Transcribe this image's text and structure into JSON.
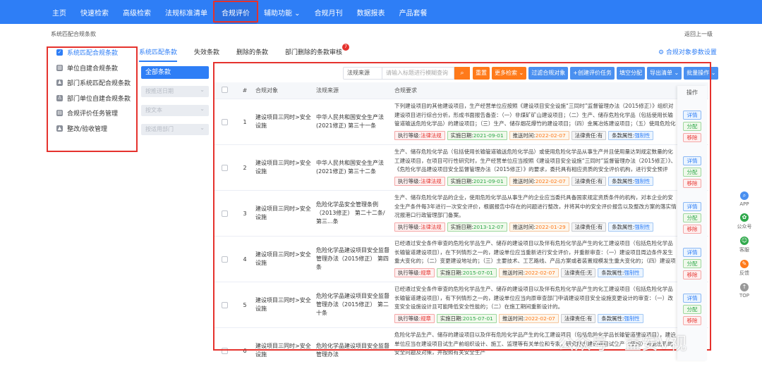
{
  "nav": {
    "items": [
      "主页",
      "快速检索",
      "高级检索",
      "法规标准清单",
      "合规评价",
      "辅助功能",
      "合规月刊",
      "数据报表",
      "产品套餐"
    ],
    "active_index": 4,
    "dropdown_index": 5
  },
  "breadcrumb": "系统匹配合规条款",
  "back_link": "返回上一级",
  "sidebar": {
    "items": [
      {
        "label": "系统匹配合规条款",
        "icon": "checkbox-icon",
        "active": true
      },
      {
        "label": "单位自建合规条款",
        "icon": "building-icon",
        "active": false
      },
      {
        "label": "部门系统匹配合规条款",
        "icon": "department-icon",
        "active": false
      },
      {
        "label": "部门单位自建合规条款",
        "icon": "department-user-icon",
        "active": false
      },
      {
        "label": "合规评价任务管理",
        "icon": "task-icon",
        "active": false
      },
      {
        "label": "整改/验收管理",
        "icon": "warning-icon",
        "active": false
      }
    ]
  },
  "tabs": {
    "items": [
      "系统匹配条款",
      "失效条款",
      "删除的条款",
      "部门删除的条款审核"
    ],
    "active_index": 0,
    "badge": "7"
  },
  "settings_link": "⚙ 合规对象参数设置",
  "filters": {
    "all": "全部条款",
    "selects": [
      "按推送日期",
      "按文本",
      "按适用部门"
    ]
  },
  "toolbar": {
    "source_select": "法规来源",
    "search_placeholder": "请输入标题进行模糊查询",
    "buttons": [
      "重置",
      "更多检索 ⌄",
      "过滤合规对象",
      "+创建评价任务",
      "填空分配",
      "导出清单 ⌄",
      "批量操作 ⌄"
    ]
  },
  "table": {
    "headers": [
      "#",
      "合规对象",
      "法规来源",
      "合规要求",
      "操作"
    ],
    "tag_labels": {
      "level": "执行等级:",
      "impl": "实施日期:",
      "push": "推送时间:",
      "resp": "法律责任:",
      "attr": "条款属性:"
    },
    "op_labels": [
      "详情",
      "分配",
      "移除"
    ],
    "rows": [
      {
        "no": "1",
        "obj": "建设项目三同时>安全设施",
        "src": "中华人民共和国安全生产法(2021修正) 第三十一条",
        "req": "下列建设项目的其他建设项目，生产经营单位应按照《建设项目安全设施“三同时”监督管理办法（2015修正）》组织对建设项目进行综合分析，形成书面报告备查：（一）非煤矿矿山建设项目；（二）生产、储存危险化学品（包括使用长输管道输送危险化学品）的建设项目；（三）生产、储存烟花爆竹的建设项目；（四）金属冶炼建设项目；（五）使用危险化学品从事生产并且使用量达到规定数量的化工建设项目；（六）法律、行政法规和国务院规定的其他建设项目。",
        "level": "法律法规",
        "impl": "2021-09-01",
        "push": "2022-02-07",
        "resp": "有",
        "attr": "强制性"
      },
      {
        "no": "2",
        "obj": "建设项目三同时>安全设施",
        "src": "中华人民共和国安全生产法(2021修正) 第三十二条",
        "req": "生产、储存危险化学品（包括使用长输管道输送危险化学品）或使用危险化学品从事生产并且使用量达到规定数量的化工建设项目，在项目可行性研究时，生产经营单位应当按照《建设项目安全设施“三同时”监督管理办法（2015修正）》、《危险化学品建设项目安全监督管理办法（2015修正）》的要求，委托具有相应资质的安全评价机构，进行安全预评价，并编制安全预评价报告。",
        "level": "法律法规",
        "impl": "2021-09-01",
        "push": "2022-02-07",
        "resp": "有",
        "attr": "强制性"
      },
      {
        "no": "3",
        "obj": "建设项目三同时>安全设施",
        "src": "危险化学品安全管理条例（2013修正） 第二十二条/第三...条",
        "req": "生产、储存危险化学品的企业，使用危险化学品从事生产的企业应当委托具备国家规定资质条件的机构，对本企业的安全生产条件每3年进行一次安全评价，根据报告中存在的问题进行整改，并将其中的安全评价报告以及整改方案的落实情况报港口行政管理部门备案。",
        "level": "法律法规",
        "impl": "2013-12-07",
        "push": "2022-01-29",
        "resp": "有",
        "attr": "强制性"
      },
      {
        "no": "4",
        "obj": "建设项目三同时>安全设施",
        "src": "危险化学品建设项目安全监督管理办法（2015修正） 第四条",
        "req": "已经通过安全条件审查的危险化学品生产、储存的建设项目以及伴有危险化学品产生的化工建设项目（包括危险化学品长输管道建设项目），在下列情形之一的，建设单位应当重新进行安全评价，并重新审查：（一）建设项目周边条件发生重大变化的；（二）变更建设地址的；（三）主要技术、工艺路线、产品方案或者装置规模发生重大变化的；（四）建设项目在安全条件审查意见书有效期内未开工建设，期限届满后需要开工建设的。",
        "level": "规章",
        "impl": "2015-07-01",
        "push": "2022-02-07",
        "resp": "无",
        "attr": "强制性"
      },
      {
        "no": "5",
        "obj": "建设项目三同时>安全设施",
        "src": "危险化学品建设项目安全监督管理办法（2015修正） 第二十条",
        "req": "已经通过安全条件审查的危险化学品生产、储存的建设项目以及伴有危险化学品产生的化工建设项目（包括危险化学品长输管道建设项目），有下列情形之一的，建设单位应当向原审查部门申请建设项目安全设施变更设计的审查：（一）改变安全设施设计且可能降低安全性能的；（二）在施工期间重新设计的。",
        "level": "规章",
        "impl": "2015-07-01",
        "push": "2022-02-07",
        "resp": "有",
        "attr": "强制性"
      },
      {
        "no": "6",
        "obj": "建设项目三同时>安全设施",
        "src": "危险化学品建设项目安全监督管理办法",
        "req": "危险化学品生产、储存的建设项目以及伴有危险化学品产生的化工建设项目（包括危险化学品长输管道建设项目），建设单位应当在建设项目试生产前组织设计、施工、监理等有关单位和专家，研究提出建设项目试生产（使用）可能出现的安全问题及对策，并按照有关安全生产"
      }
    ]
  },
  "right_bar": [
    "APP",
    "公众号",
    "客服",
    "反馈",
    "TOP"
  ],
  "watermark": "公众号 · 益安V视"
}
